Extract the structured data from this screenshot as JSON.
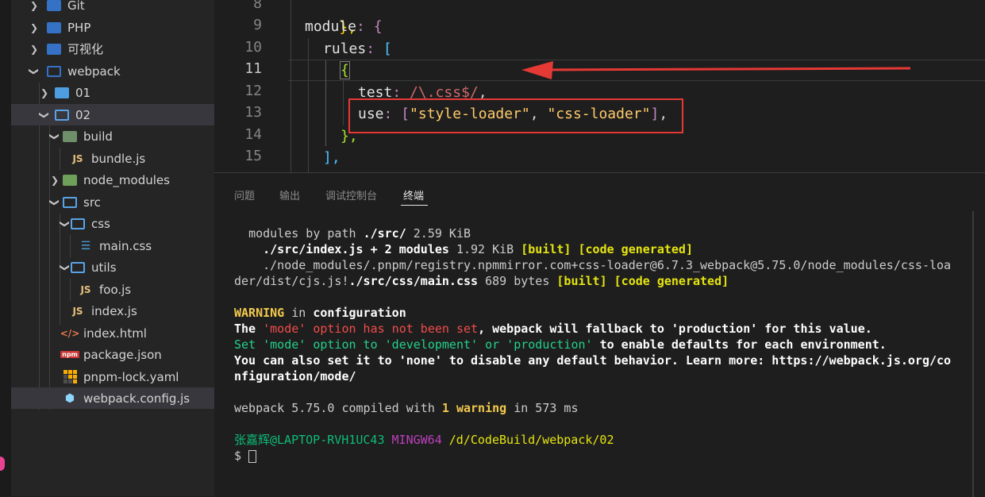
{
  "explorer": {
    "items": [
      {
        "label": "Git",
        "icon": "folder-icon"
      },
      {
        "label": "PHP",
        "icon": "folder-icon"
      },
      {
        "label": "可视化",
        "icon": "folder-icon"
      },
      {
        "label": "webpack",
        "icon": "folder-icon"
      },
      {
        "label": "01",
        "icon": "folder-icon"
      },
      {
        "label": "02",
        "icon": "folder-icon"
      },
      {
        "label": "build",
        "icon": "build-folder-icon"
      },
      {
        "label": "bundle.js",
        "icon": "javascript-icon"
      },
      {
        "label": "node_modules",
        "icon": "node-modules-folder-icon"
      },
      {
        "label": "src",
        "icon": "folder-icon"
      },
      {
        "label": "css",
        "icon": "folder-icon"
      },
      {
        "label": "main.css",
        "icon": "css-icon"
      },
      {
        "label": "utils",
        "icon": "folder-icon"
      },
      {
        "label": "foo.js",
        "icon": "javascript-icon"
      },
      {
        "label": "index.js",
        "icon": "javascript-icon"
      },
      {
        "label": "index.html",
        "icon": "html-icon"
      },
      {
        "label": "package.json",
        "icon": "npm-icon"
      },
      {
        "label": "pnpm-lock.yaml",
        "icon": "pnpm-icon"
      },
      {
        "label": "webpack.config.js",
        "icon": "webpack-icon"
      }
    ]
  },
  "editor": {
    "line_numbers": [
      "8",
      "9",
      "10",
      "11",
      "12",
      "13",
      "14",
      "15"
    ],
    "lines": {
      "l8": {
        "brace": "},"
      },
      "l9": {
        "key": "module",
        "colon": ":",
        "brace": "{"
      },
      "l10": {
        "key": "rules",
        "colon": ":",
        "bracket": "["
      },
      "l11": {
        "brace": "{"
      },
      "l12": {
        "key": "test",
        "colon": ":",
        "regex": "/\\.css$/",
        "comma": ","
      },
      "l13": {
        "key": "use",
        "colon": ":",
        "open": "[",
        "s1": "\"style-loader\"",
        "sep": ", ",
        "s2": "\"css-loader\"",
        "close": "]",
        "comma": ","
      },
      "l14": {
        "brace": "},"
      },
      "l15": {
        "bracket": "],"
      }
    }
  },
  "panel": {
    "tabs": [
      "问题",
      "输出",
      "调试控制台",
      "终端"
    ],
    "active_tab": "终端"
  },
  "terminal": {
    "l1": {
      "a": "modules by path ",
      "b": "./src/",
      "c": " 2.59 KiB"
    },
    "l2": {
      "a": "./src/index.js + 2 modules",
      "b": " 1.92 KiB ",
      "c": "[built]",
      "d": " ",
      "e": "[code generated]"
    },
    "l3": {
      "a": "./node_modules/.pnpm/registry.npmmirror.com+css-loader@6.7.3_webpack@5.75.0/node_modules/css-loa"
    },
    "l4": {
      "a": "der/dist/cjs.js!",
      "b": "./src/css/main.css",
      "c": " 689 bytes ",
      "d": "[built]",
      "e": " ",
      "f": "[code generated]"
    },
    "l5": {
      "a": "WARNING",
      "b": " in ",
      "c": "configuration"
    },
    "l6": {
      "a": "The ",
      "b": "'mode' option has not been set",
      "c": ", webpack will fallback to 'production' for this value."
    },
    "l7": {
      "a": "Set 'mode' option to 'development' or 'production'",
      "b": " to enable defaults for each environment."
    },
    "l8": {
      "a": "You can also set it to 'none' to disable any default behavior. Learn more: https://webpack.js.org/co"
    },
    "l9": {
      "a": "nfiguration/mode/"
    },
    "l10": {
      "a": "webpack 5.75.0 compiled with ",
      "b": "1 warning",
      "c": " in 573 ms"
    },
    "l11": {
      "a": "张嘉辉@LAPTOP-RVH1UC43",
      "b": " MINGW64",
      "c": " /d/CodeBuild/webpack/02"
    },
    "l12": {
      "a": "$ "
    }
  },
  "colors": {
    "annotation": "#e53935",
    "selected_row": "#37373d"
  }
}
